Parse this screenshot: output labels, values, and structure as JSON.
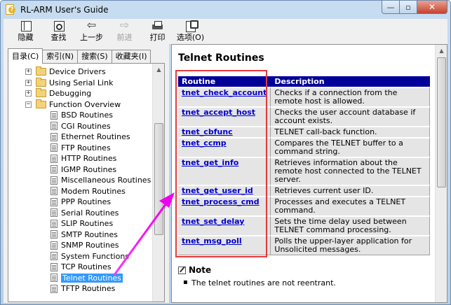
{
  "window": {
    "title": "RL-ARM User's Guide",
    "min_glyph": "—",
    "max_glyph": "▫",
    "close_glyph": "✕"
  },
  "toolbar": {
    "hide_label": "隐藏",
    "find_label": "查找",
    "back_label": "上一步",
    "forward_label": "前进",
    "print_label": "打印",
    "options_label": "选项(O)"
  },
  "tabs": [
    {
      "label": "目录(C)"
    },
    {
      "label": "索引(N)"
    },
    {
      "label": "搜索(S)"
    },
    {
      "label": "收藏夹(I)"
    }
  ],
  "tree": {
    "folders": [
      {
        "label": "Device Drivers",
        "expander": "+"
      },
      {
        "label": "Using Serial Link",
        "expander": "+"
      },
      {
        "label": "Debugging",
        "expander": "+"
      },
      {
        "label": "Function Overview",
        "expander": "−"
      }
    ],
    "pages": [
      "BSD Routines",
      "CGI Routines",
      "Ethernet Routines",
      "FTP Routines",
      "HTTP Routines",
      "IGMP Routines",
      "Miscellaneous  Routines",
      "Modem Routines",
      "PPP Routines",
      "Serial Routines",
      "SLIP Routines",
      "SMTP Routines",
      "SNMP Routines",
      "System Functions",
      "TCP Routines",
      "Telnet Routines",
      "TFTP Routines"
    ],
    "selected": "Telnet Routines"
  },
  "content": {
    "title": "Telnet Routines",
    "table": {
      "headers": [
        "Routine",
        "Description"
      ],
      "rows": [
        {
          "routine": "tnet_check_account",
          "description": "Checks if a connection from the remote host is allowed."
        },
        {
          "routine": "tnet_accept_host",
          "description": "Checks the user account database if account exists."
        },
        {
          "routine": "tnet_cbfunc",
          "description": "TELNET call-back function."
        },
        {
          "routine": "tnet_ccmp",
          "description": "Compares the TELNET buffer to a command string."
        },
        {
          "routine": "tnet_get_info",
          "description": "Retrieves information about the remote host connected to the TELNET server."
        },
        {
          "routine": "tnet_get_user_id",
          "description": "Retrieves current user ID."
        },
        {
          "routine": "tnet_process_cmd",
          "description": "Processes and executes a TELNET command."
        },
        {
          "routine": "tnet_set_delay",
          "description": "Sets the time delay used between TELNET command processing."
        },
        {
          "routine": "tnet_msg_poll",
          "description": "Polls the upper-layer application for Unsolicited messages."
        }
      ]
    },
    "note_heading": "Note",
    "note_text": "The telnet routines are not reentrant."
  },
  "colors": {
    "table_header": "#000099",
    "link": "#0000cc",
    "highlight_box": "#e43b3b",
    "annotation_arrow": "#ff33ff",
    "selection": "#3399ff"
  }
}
